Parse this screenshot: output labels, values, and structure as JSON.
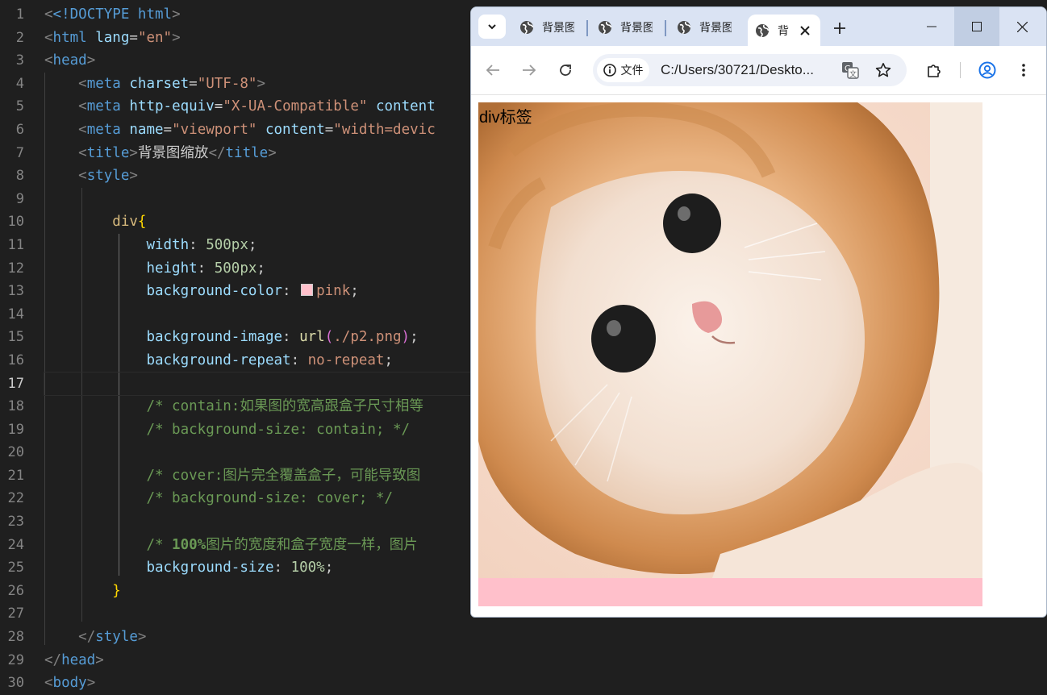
{
  "editor": {
    "line_numbers": [
      "1",
      "2",
      "3",
      "4",
      "5",
      "6",
      "7",
      "8",
      "9",
      "10",
      "11",
      "12",
      "13",
      "14",
      "15",
      "16",
      "17",
      "18",
      "19",
      "20",
      "21",
      "22",
      "23",
      "24",
      "25",
      "26",
      "27",
      "28",
      "29",
      "30"
    ],
    "code": {
      "l1_doctype": "<!DOCTYPE",
      "l1_html": " html",
      "l1_close": ">",
      "l2_open": "<",
      "l2_tag": "html",
      "l2_attr": " lang",
      "l2_eq": "=",
      "l2_val": "\"en\"",
      "l2_close": ">",
      "l3_tag": "head",
      "l4_tag": "meta",
      "l4_attr": " charset",
      "l4_val": "\"UTF-8\"",
      "l5_tag": "meta",
      "l5_attr": " http-equiv",
      "l5_val": "\"X-UA-Compatible\"",
      "l5_attr2": " content",
      "l6_tag": "meta",
      "l6_attr": " name",
      "l6_val": "\"viewport\"",
      "l6_attr2": " content",
      "l6_val2": "\"width=devic",
      "l7_tag": "title",
      "l7_text": "背景图缩放",
      "l7_endtag": "title",
      "l8_tag": "style",
      "l10_sel": "div",
      "l10_brace": "{",
      "l11_prop": "width",
      "l11_val": "500px",
      "l12_prop": "height",
      "l12_val": "500px",
      "l13_prop": "background-color",
      "l13_val": "pink",
      "l15_prop": "background-image",
      "l15_fn": "url",
      "l15_arg": "./p2.png",
      "l16_prop": "background-repeat",
      "l16_val": "no-repeat",
      "l18_cmt": "/* contain:如果图的宽高跟盒子尺寸相等",
      "l19_cmt": "/* background-size: contain; */",
      "l21_cmt": "/* cover:图片完全覆盖盒子，可能导致图",
      "l22_cmt": "/* background-size: cover; */",
      "l24_cmt_a": "/* ",
      "l24_cmt_num": "100%",
      "l24_cmt_b": "图片的宽度和盒子宽度一样，图片",
      "l25_prop": "background-size",
      "l25_val": "100%",
      "l26_brace": "}",
      "l28_tag": "style",
      "l29_tag": "head",
      "l30_tag": "body"
    },
    "active_line": "17",
    "swatch_color": "#ffc0cb"
  },
  "browser": {
    "tabs": [
      {
        "label": "背景图",
        "icon": "globe-icon"
      },
      {
        "label": "背景图",
        "icon": "globe-icon"
      },
      {
        "label": "背景图",
        "icon": "globe-icon"
      },
      {
        "label": "背",
        "icon": "globe-icon",
        "active": true
      }
    ],
    "security_chip": "文件",
    "url": "C:/Users/30721/Deskto...",
    "page_text": "div标签",
    "box_color": "#ffc0cb",
    "accent": "#1a73e8"
  }
}
